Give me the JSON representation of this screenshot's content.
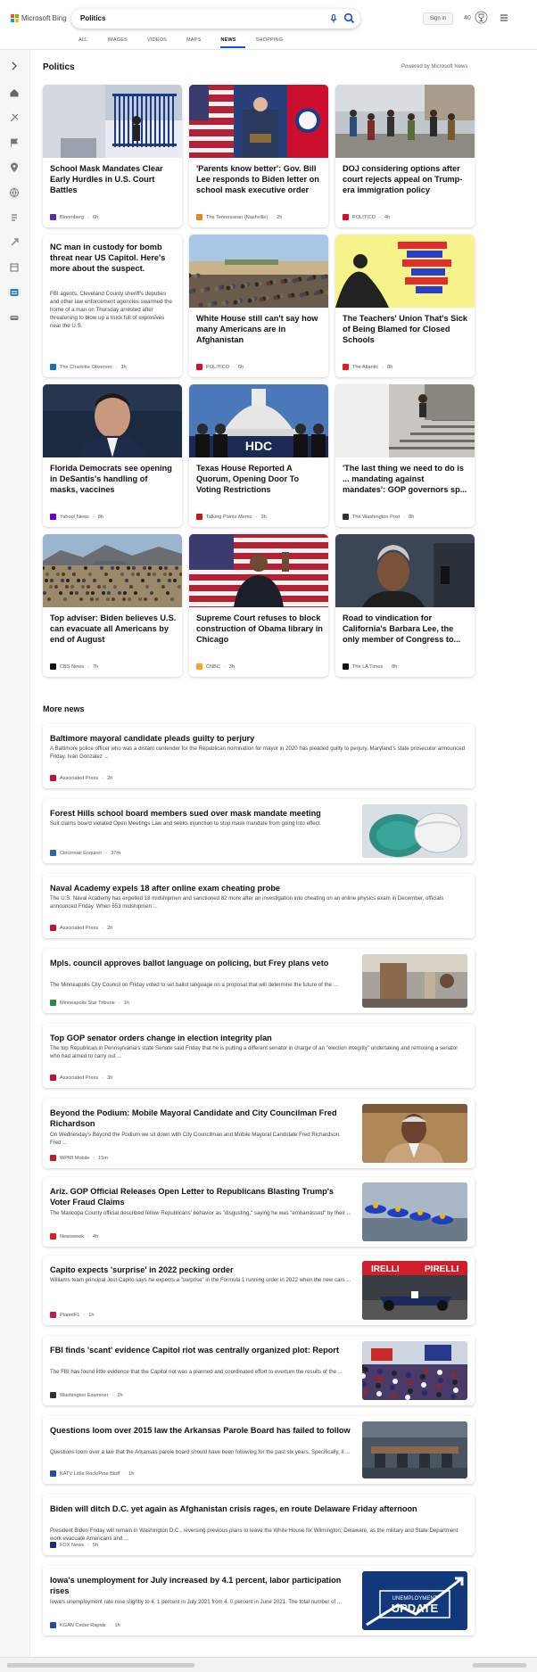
{
  "brand": {
    "name": "Microsoft Bing"
  },
  "search": {
    "query": "Politics"
  },
  "header": {
    "signin_label": "Sign in",
    "points": "40"
  },
  "tabs": [
    {
      "label": "ALL",
      "active": false
    },
    {
      "label": "IMAGES",
      "active": false
    },
    {
      "label": "VIDEOS",
      "active": false
    },
    {
      "label": "MAPS",
      "active": false
    },
    {
      "label": "NEWS",
      "active": true
    },
    {
      "label": "SHOPPING",
      "active": false
    }
  ],
  "section": {
    "title": "Politics",
    "powered_by": "Powered by Microsoft News"
  },
  "top_stories": [
    {
      "title": "School Mask Mandates Clear Early Hurdles in U.S. Court Battles",
      "source": "Bloomberg",
      "age": "6h",
      "icon_color": "#5a2d9c"
    },
    {
      "title": "'Parents know better': Gov. Bill Lee responds to Biden letter on school mask executive order",
      "source": "The Tennessean (Nashville)",
      "age": "2h",
      "icon_color": "#e08a1e"
    },
    {
      "title": "DOJ considering options after court rejects appeal on Trump-era immigration policy",
      "source": "POLITICO",
      "age": "4h",
      "icon_color": "#d0112b"
    },
    {
      "title": "NC man in custody for bomb threat near US Capitol. Here's more about the suspect.",
      "summary": "FBI agents, Cleveland County sheriff's deputies and other law enforcement agencies swarmed the home of a man on Thursday arrested after threatening to blow up a truck full of explosives near the U.S.",
      "source": "The Charlotte Observer",
      "age": "3h",
      "icon_color": "#1b6fb5"
    },
    {
      "title": "White House still can't say how many Americans are in Afghanistan",
      "source": "POLITICO",
      "age": "6h",
      "icon_color": "#d0112b"
    },
    {
      "title": "The Teachers' Union That's Sick of Being Blamed for Closed Schools",
      "source": "The Atlantic",
      "age": "8h",
      "icon_color": "#e01b22"
    },
    {
      "title": "Florida Democrats see opening in DeSantis's handling of masks, vaccines",
      "source": "Yahoo! News",
      "age": "8h",
      "icon_color": "#6001d2"
    },
    {
      "title": "Texas House Reported A Quorum, Opening Door To Voting Restrictions",
      "source": "Talking Points Memo",
      "age": "3h",
      "icon_color": "#c21a1a"
    },
    {
      "title": "'The last thing we need to do is ... mandating against mandates': GOP governors sp...",
      "source": "The Washington Post",
      "age": "8h",
      "icon_color": "#333333"
    },
    {
      "title": "Top adviser: Biden believes U.S. can evacuate all Americans by end of August",
      "source": "CBS News",
      "age": "7h",
      "icon_color": "#111111"
    },
    {
      "title": "Supreme Court refuses to block construction of Obama library in Chicago",
      "source": "CNBC",
      "age": "3h",
      "icon_color": "#f5a623"
    },
    {
      "title": "Road to vindication for California's Barbara Lee, the only member of Congress to...",
      "source": "The LA Times",
      "age": "8h",
      "icon_color": "#111111"
    }
  ],
  "more_news": {
    "title": "More news",
    "items": [
      {
        "title": "Baltimore mayoral candidate pleads guilty to perjury",
        "summary": "A Baltimore police officer who was a distant contender for the Republican nomination for mayor in 2020 has pleaded guilty to perjury, Maryland's state prosecutor announced Friday. Ivan Gonzalez ...",
        "source": "Associated Press",
        "age": "2h",
        "icon_color": "#c8102e"
      },
      {
        "title": "Forest Hills school board members sued over mask mandate meeting",
        "summary": "Suit claims board violated Open Meetings Law and seeks injunction to stop mask mandate from going into effect.",
        "source": "Cincinnati Enquirer",
        "age": "37m",
        "icon_color": "#2f66b3"
      },
      {
        "title": "Naval Academy expels 18 after online exam cheating probe",
        "summary": "The U.S. Naval Academy has expelled 18 midshipmen and sanctioned 82 more after an investigation into cheating on an online physics exam in December, officials announced Friday. When 653 midshipmen ...",
        "source": "Associated Press",
        "age": "2h",
        "icon_color": "#c8102e"
      },
      {
        "title": "Mpls. council approves ballot language on policing, but Frey plans veto",
        "summary": "The Minneapolis City Council on Friday voted to set ballot language on a proposal that will determine the future of the ...",
        "source": "Minneapolis Star Tribune",
        "age": "1h",
        "icon_color": "#2e8b3d"
      },
      {
        "title": "Top GOP senator orders change in election integrity plan",
        "summary": "The top Republican in Pennsylvania's state Senate said Friday that he is putting a different senator in charge of an \"election integrity\" undertaking and removing a senator who had aimed to carry out ...",
        "source": "Associated Press",
        "age": "3h",
        "icon_color": "#c8102e"
      },
      {
        "title": "Beyond the Podium: Mobile Mayoral Candidate and City Councilman Fred Richardson",
        "summary": "On Wednesday's Beyond the Podium we sit down with City Councilman and Mobile Mayoral Candidate Fred Richardson. Fred ...",
        "source": "WPMI Mobile",
        "age": "15m",
        "icon_color": "#c21a1a"
      },
      {
        "title": "Ariz. GOP Official Releases Open Letter to Republicans Blasting Trump's Voter Fraud Claims",
        "summary": "The Maricopa County official described fellow Republicans' behavior as \"disgusting,\" saying he was \"embarrassed\" by their ...",
        "source": "Newsweek",
        "age": "4h",
        "icon_color": "#e01b22"
      },
      {
        "title": "Capito expects 'surprise' in 2022 pecking order",
        "summary": "Williams team principal Jost Capito says he expects a \"surprise\" in the Formula 1 running order in 2022 when the new cars ...",
        "source": "PlanetF1",
        "age": "1h",
        "icon_color": "#c2185b"
      },
      {
        "title": "FBI finds 'scant' evidence Capitol riot was centrally organized plot: Report",
        "summary": "The FBI has found little evidence that the Capitol riot was a planned and coordinated effort to overturn the results of the ...",
        "source": "Washington Examiner",
        "age": "2h",
        "icon_color": "#333333"
      },
      {
        "title": "Questions loom over 2015 law the Arkansas Parole Board has failed to follow",
        "summary": "Questions loom over a law that the Arkansas parole board should have been following for the past six years. Specifically, it ...",
        "source": "KATV Little Rock/Pine Bluff",
        "age": "1h",
        "icon_color": "#1e4fa3"
      },
      {
        "title": "Biden will ditch D.C. yet again as Afghanistan crisis rages, en route Delaware Friday afternoon",
        "summary": "President Biden Friday will remain in Washington D.C., reversing previous plans to leave the White House for Wilmington, Delaware, as the military and State Department work evacuate Americans and ...",
        "source": "FOX News",
        "age": "5h",
        "icon_color": "#1a2f6b"
      },
      {
        "title": "Iowa's unemployment for July increased by 4.1 percent, labor participation rises",
        "summary": "Iowa's unemployment rate rose slightly to 4. 1 percent in July 2021 from 4. 0 percent in June 2021. The total number of ...",
        "source": "KGAN Cedar Rapids",
        "age": "1h",
        "icon_color": "#1e4fa3",
        "image_text_top": "UNEMPLOYMENT",
        "image_text_main": "UPDATE"
      }
    ]
  }
}
